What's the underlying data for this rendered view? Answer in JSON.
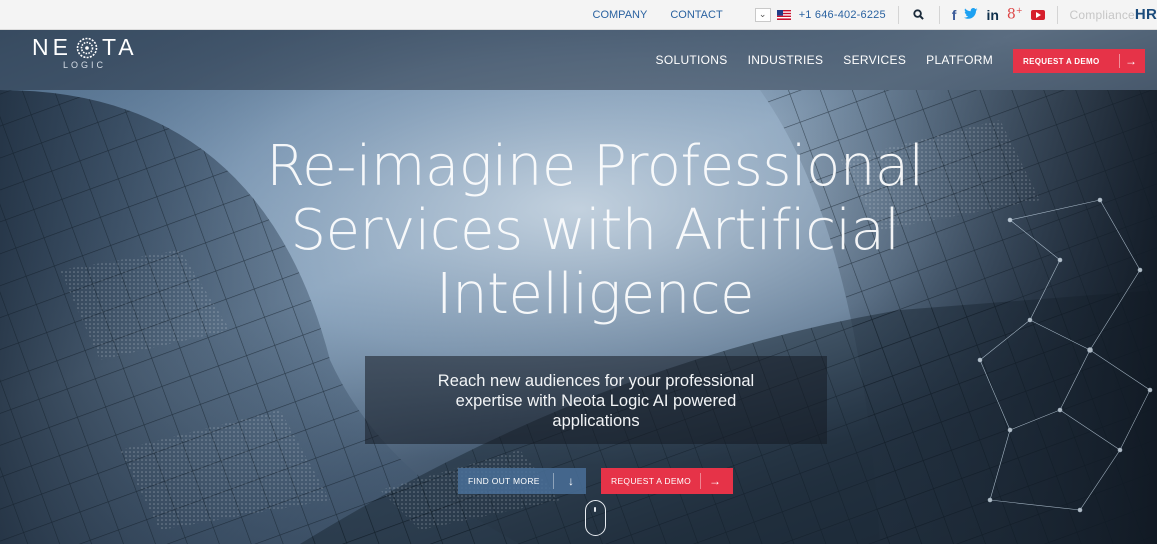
{
  "topbar": {
    "links": [
      "COMPANY",
      "CONTACT"
    ],
    "phone": "+1 646-402-6225",
    "compliance_prefix": "Compliance",
    "compliance_brand": "HR",
    "social_icons": [
      "facebook-icon",
      "twitter-icon",
      "linkedin-icon",
      "googleplus-icon",
      "youtube-icon"
    ]
  },
  "logo": {
    "word_left": "NE",
    "word_right": "TA",
    "sub": "LOGIC"
  },
  "nav": {
    "items": [
      "SOLUTIONS",
      "INDUSTRIES",
      "SERVICES",
      "PLATFORM"
    ],
    "cta": "REQUEST A DEMO"
  },
  "hero": {
    "headline_1": "Re-imagine Professional",
    "headline_2": "Services with Artificial",
    "headline_3": "Intelligence",
    "subtext_1": "Reach new audiences for your professional",
    "subtext_2": "expertise with Neota Logic AI powered",
    "subtext_3": "applications",
    "find_out_more": "FIND OUT MORE",
    "request_demo": "REQUEST A DEMO"
  },
  "colors": {
    "accent_red": "#e63348",
    "link_blue": "#2a62a0",
    "button_blue": "#496e98"
  }
}
